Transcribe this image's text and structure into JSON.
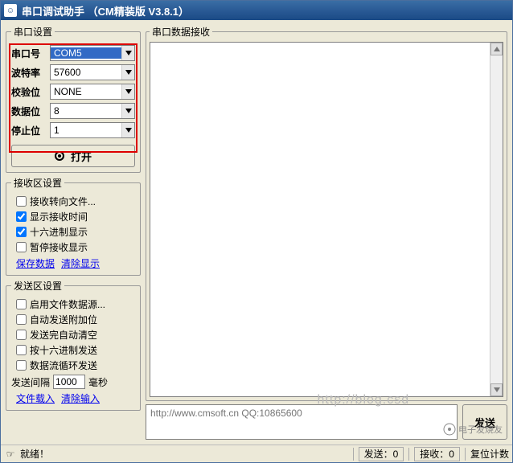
{
  "title": "串口调试助手 （CM精装版 V3.8.1）",
  "port_settings": {
    "legend": "串口设置",
    "rows": {
      "port": {
        "label": "串口号",
        "value": "COM5"
      },
      "baud": {
        "label": "波特率",
        "value": "57600"
      },
      "parity": {
        "label": "校验位",
        "value": "NONE"
      },
      "databits": {
        "label": "数据位",
        "value": "8"
      },
      "stopbits": {
        "label": "停止位",
        "value": "1"
      }
    },
    "open_label": "打开"
  },
  "recv_settings": {
    "legend": "接收区设置",
    "items": {
      "to_file": {
        "label": "接收转向文件...",
        "checked": false
      },
      "show_time": {
        "label": "显示接收时间",
        "checked": true
      },
      "hex_display": {
        "label": "十六进制显示",
        "checked": true
      },
      "pause": {
        "label": "暂停接收显示",
        "checked": false
      }
    },
    "links": {
      "save": "保存数据",
      "clear": "清除显示"
    }
  },
  "send_settings": {
    "legend": "发送区设置",
    "items": {
      "file_src": {
        "label": "启用文件数据源...",
        "checked": false
      },
      "auto_append": {
        "label": "自动发送附加位",
        "checked": false
      },
      "auto_clear": {
        "label": "发送完自动清空",
        "checked": false
      },
      "hex_send": {
        "label": "按十六进制发送",
        "checked": false
      },
      "loop_send": {
        "label": "数据流循环发送",
        "checked": false
      }
    },
    "interval": {
      "label": "发送间隔",
      "value": "1000",
      "unit": "毫秒"
    },
    "links": {
      "load": "文件载入",
      "clear": "清除输入"
    }
  },
  "recv_area": {
    "legend": "串口数据接收"
  },
  "send_area": {
    "placeholder": "http://www.cmsoft.cn QQ:10865600",
    "send_label": "发送"
  },
  "status": {
    "ready": "就绪！",
    "sent_label": "发送：",
    "sent_value": "0",
    "recv_label": "接收：",
    "recv_value": "0",
    "reset": "复位计数"
  },
  "watermark": "http://blog.csd",
  "brand": "电子发烧友"
}
